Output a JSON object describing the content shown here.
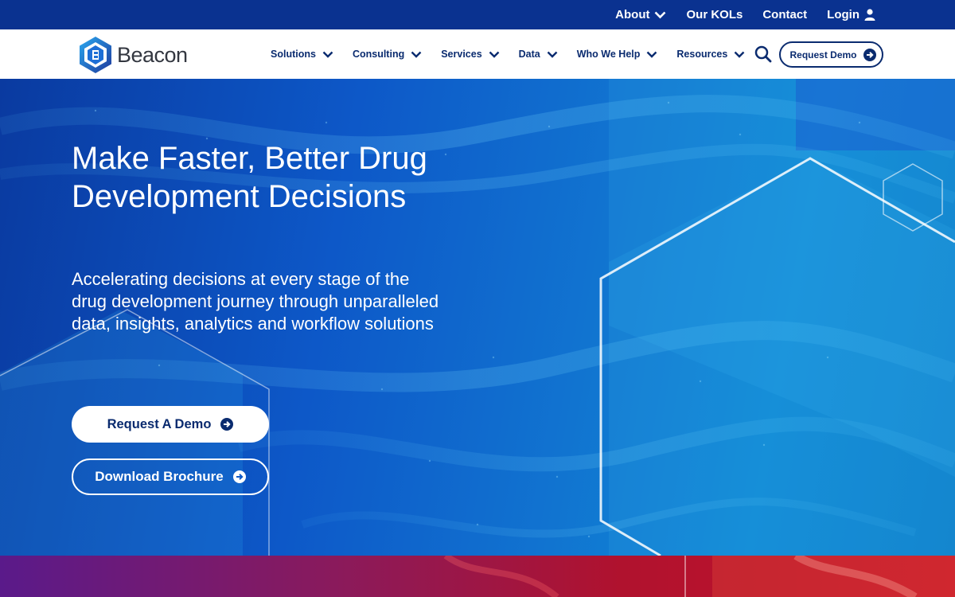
{
  "topbar": {
    "items": [
      {
        "label": "About",
        "has_dropdown": true
      },
      {
        "label": "Our KOLs"
      },
      {
        "label": "Contact"
      },
      {
        "label": "Login",
        "icon": "user-icon"
      }
    ]
  },
  "brand": {
    "name": "Beacon",
    "logo_icon": "hexagon-logo-icon"
  },
  "nav": {
    "items": [
      {
        "label": "Solutions"
      },
      {
        "label": "Consulting"
      },
      {
        "label": "Services"
      },
      {
        "label": "Data"
      },
      {
        "label": "Who We Help"
      },
      {
        "label": "Resources"
      }
    ],
    "search_icon": "search-icon",
    "cta_label": "Request Demo"
  },
  "hero": {
    "title": "Make Faster, Better Drug Development Decisions",
    "subtitle": "Accelerating decisions at every stage of the drug development journey through unparalleled data, insights, analytics and workflow solutions",
    "primary_cta": "Request A Demo",
    "secondary_cta": "Download Brochure"
  },
  "colors": {
    "topbar": "#0a3290",
    "navy": "#0a2b6f",
    "hero_blue": "#0d58c8",
    "bottom_magenta": "#8a1a5c",
    "bottom_red": "#c8142a"
  }
}
